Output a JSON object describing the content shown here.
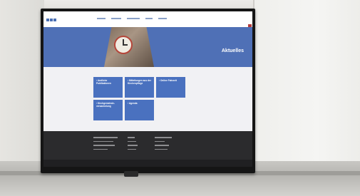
{
  "scene": {
    "description_colors": {
      "hero_blue": "#4f70b6",
      "tile_blue": "#4a71bf",
      "footer_dark": "#2b2b2d"
    }
  },
  "tv": {
    "brand": ""
  },
  "website": {
    "hero": {
      "title": "Aktuelles"
    },
    "tiles": [
      {
        "label": "Amtliche Publikationen"
      },
      {
        "label": "Mitteilungen aus der Kirchenpflege"
      },
      {
        "label": "Online Fahrzeit"
      },
      {
        "label": "Kirchgemeinde-versammlung"
      },
      {
        "label": "Agenda"
      }
    ]
  }
}
